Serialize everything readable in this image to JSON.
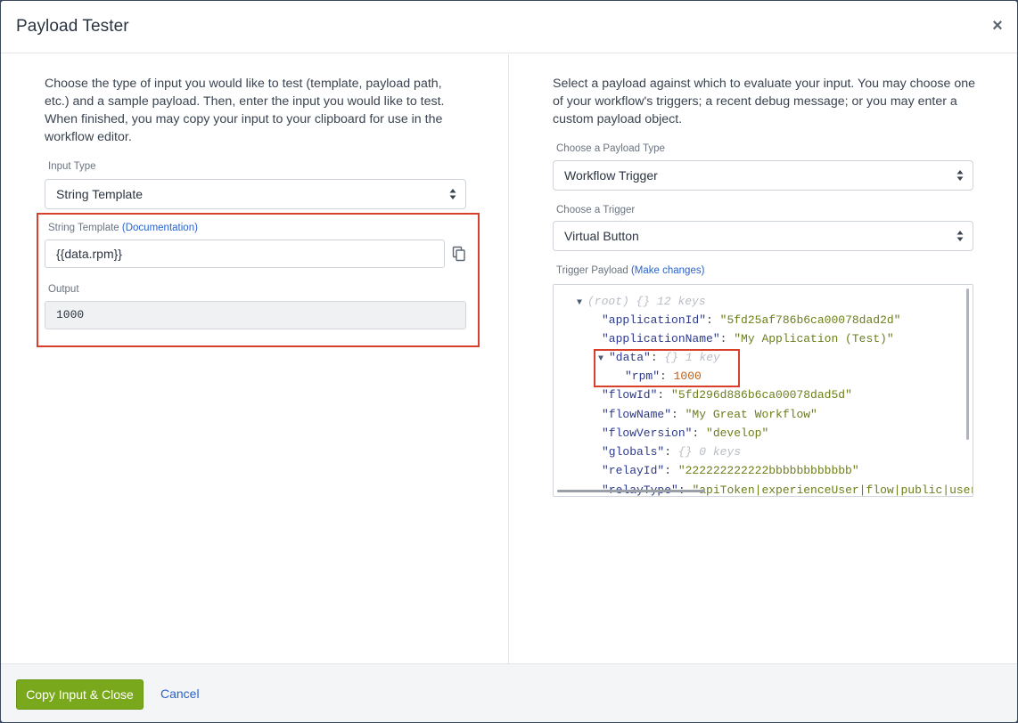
{
  "modal": {
    "title": "Payload Tester",
    "close_label": "×"
  },
  "left": {
    "intro": "Choose the type of input you would like to test (template, payload path, etc.) and a sample payload. Then, enter the input you would like to test. When finished, you may copy your input to your clipboard for use in the workflow editor.",
    "input_type_label": "Input Type",
    "input_type_value": "String Template",
    "template_label": "String Template",
    "template_link": "(Documentation)",
    "template_value": "{{data.rpm}}",
    "output_label": "Output",
    "output_value": "1000"
  },
  "right": {
    "intro": "Select a payload against which to evaluate your input. You may choose one of your workflow's triggers; a recent debug message; or you may enter a custom payload object.",
    "payload_type_label": "Choose a Payload Type",
    "payload_type_value": "Workflow Trigger",
    "trigger_label": "Choose a Trigger",
    "trigger_value": "Virtual Button",
    "payload_label": "Trigger Payload",
    "payload_link": "(Make changes)",
    "json": {
      "root_label": "(root)",
      "root_braces": "{}",
      "root_meta": "12 keys",
      "applicationId_key": "\"applicationId\"",
      "applicationId_val": "\"5fd25af786b6ca00078dad2d\"",
      "applicationName_key": "\"applicationName\"",
      "applicationName_val": "\"My Application (Test)\"",
      "data_key": "\"data\"",
      "data_braces": "{}",
      "data_meta": "1 key",
      "rpm_key": "\"rpm\"",
      "rpm_val": "1000",
      "flowId_key": "\"flowId\"",
      "flowId_val": "\"5fd296d886b6ca00078dad5d\"",
      "flowName_key": "\"flowName\"",
      "flowName_val": "\"My Great Workflow\"",
      "flowVersion_key": "\"flowVersion\"",
      "flowVersion_val": "\"develop\"",
      "globals_key": "\"globals\"",
      "globals_braces": "{}",
      "globals_meta": "0 keys",
      "relayId_key": "\"relayId\"",
      "relayId_val": "\"222222222222bbbbbbbbbbbb\"",
      "relayType_key": "\"relayType\"",
      "relayType_val": "\"apiToken|experienceUser|flow|public|user"
    }
  },
  "footer": {
    "primary_label": "Copy Input & Close",
    "cancel_label": "Cancel"
  },
  "colors": {
    "accent_green": "#7aa81d",
    "link_blue": "#2b63c9",
    "highlight_red": "#d9402b"
  }
}
